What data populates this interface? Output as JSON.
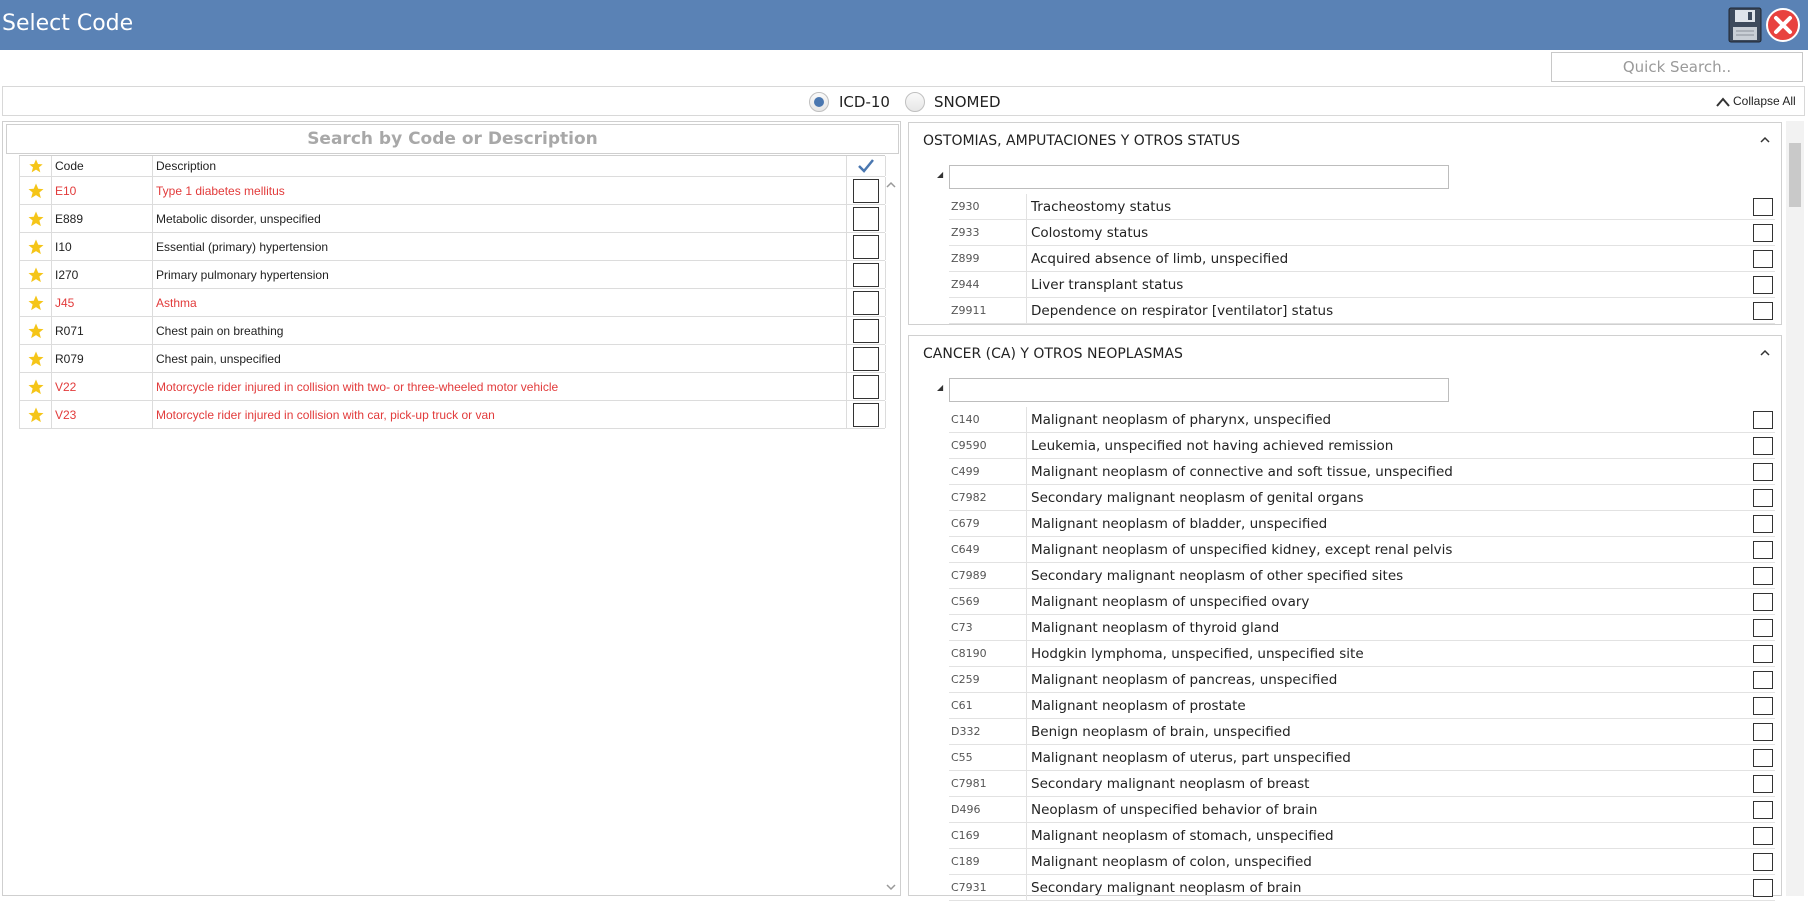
{
  "window": {
    "title": "Select Code"
  },
  "icons": {
    "save": "floppy-disk-icon",
    "close": "close-circle-icon"
  },
  "quick_search": {
    "placeholder": "Quick Search.."
  },
  "code_system": {
    "options": [
      "ICD-10",
      "SNOMED"
    ],
    "selected": "ICD-10",
    "collapse_all_label": "Collapse All"
  },
  "favorites": {
    "search_placeholder": "Search by Code or Description",
    "columns": {
      "code": "Code",
      "description": "Description"
    },
    "rows": [
      {
        "code": "E10",
        "description": "Type 1 diabetes mellitus",
        "highlight": true
      },
      {
        "code": "E889",
        "description": "Metabolic disorder, unspecified",
        "highlight": false
      },
      {
        "code": "I10",
        "description": "Essential (primary) hypertension",
        "highlight": false
      },
      {
        "code": "I270",
        "description": "Primary pulmonary hypertension",
        "highlight": false
      },
      {
        "code": "J45",
        "description": "Asthma",
        "highlight": true
      },
      {
        "code": "R071",
        "description": "Chest pain on breathing",
        "highlight": false
      },
      {
        "code": "R079",
        "description": "Chest pain, unspecified",
        "highlight": false
      },
      {
        "code": "V22",
        "description": "Motorcycle rider injured in collision with two- or three-wheeled motor vehicle",
        "highlight": true
      },
      {
        "code": "V23",
        "description": "Motorcycle rider injured in collision with car, pick-up truck or van",
        "highlight": true
      }
    ]
  },
  "groups": [
    {
      "title": "OSTOMIAS, AMPUTACIONES Y OTROS STATUS",
      "rows": [
        {
          "code": "Z930",
          "description": "Tracheostomy status"
        },
        {
          "code": "Z933",
          "description": "Colostomy status"
        },
        {
          "code": "Z899",
          "description": "Acquired absence of limb, unspecified"
        },
        {
          "code": "Z944",
          "description": "Liver transplant status"
        },
        {
          "code": "Z9911",
          "description": "Dependence on respirator [ventilator] status"
        }
      ]
    },
    {
      "title": "CANCER (CA) Y OTROS NEOPLASMAS",
      "rows": [
        {
          "code": "C140",
          "description": "Malignant neoplasm of pharynx, unspecified"
        },
        {
          "code": "C9590",
          "description": "Leukemia, unspecified not having achieved remission"
        },
        {
          "code": "C499",
          "description": "Malignant neoplasm of connective and soft tissue, unspecified"
        },
        {
          "code": "C7982",
          "description": "Secondary malignant neoplasm of genital organs"
        },
        {
          "code": "C679",
          "description": "Malignant neoplasm of bladder, unspecified"
        },
        {
          "code": "C649",
          "description": "Malignant neoplasm of unspecified kidney, except renal pelvis"
        },
        {
          "code": "C7989",
          "description": "Secondary malignant neoplasm of other specified sites"
        },
        {
          "code": "C569",
          "description": "Malignant neoplasm of unspecified ovary"
        },
        {
          "code": "C73",
          "description": "Malignant neoplasm of thyroid gland"
        },
        {
          "code": "C8190",
          "description": "Hodgkin lymphoma, unspecified, unspecified site"
        },
        {
          "code": "C259",
          "description": "Malignant neoplasm of pancreas, unspecified"
        },
        {
          "code": "C61",
          "description": "Malignant neoplasm of prostate"
        },
        {
          "code": "D332",
          "description": "Benign neoplasm of brain, unspecified"
        },
        {
          "code": "C55",
          "description": "Malignant neoplasm of uterus, part unspecified"
        },
        {
          "code": "C7981",
          "description": "Secondary malignant neoplasm of breast"
        },
        {
          "code": "D496",
          "description": "Neoplasm of unspecified behavior of brain"
        },
        {
          "code": "C169",
          "description": "Malignant neoplasm of stomach, unspecified"
        },
        {
          "code": "C189",
          "description": "Malignant neoplasm of colon, unspecified"
        },
        {
          "code": "C7931",
          "description": "Secondary malignant neoplasm of brain"
        }
      ]
    }
  ],
  "colors": {
    "titlebar": "#5a82b5",
    "highlight_text": "#e23b3b",
    "star": "#f5c518",
    "accent": "#4a77b0"
  }
}
